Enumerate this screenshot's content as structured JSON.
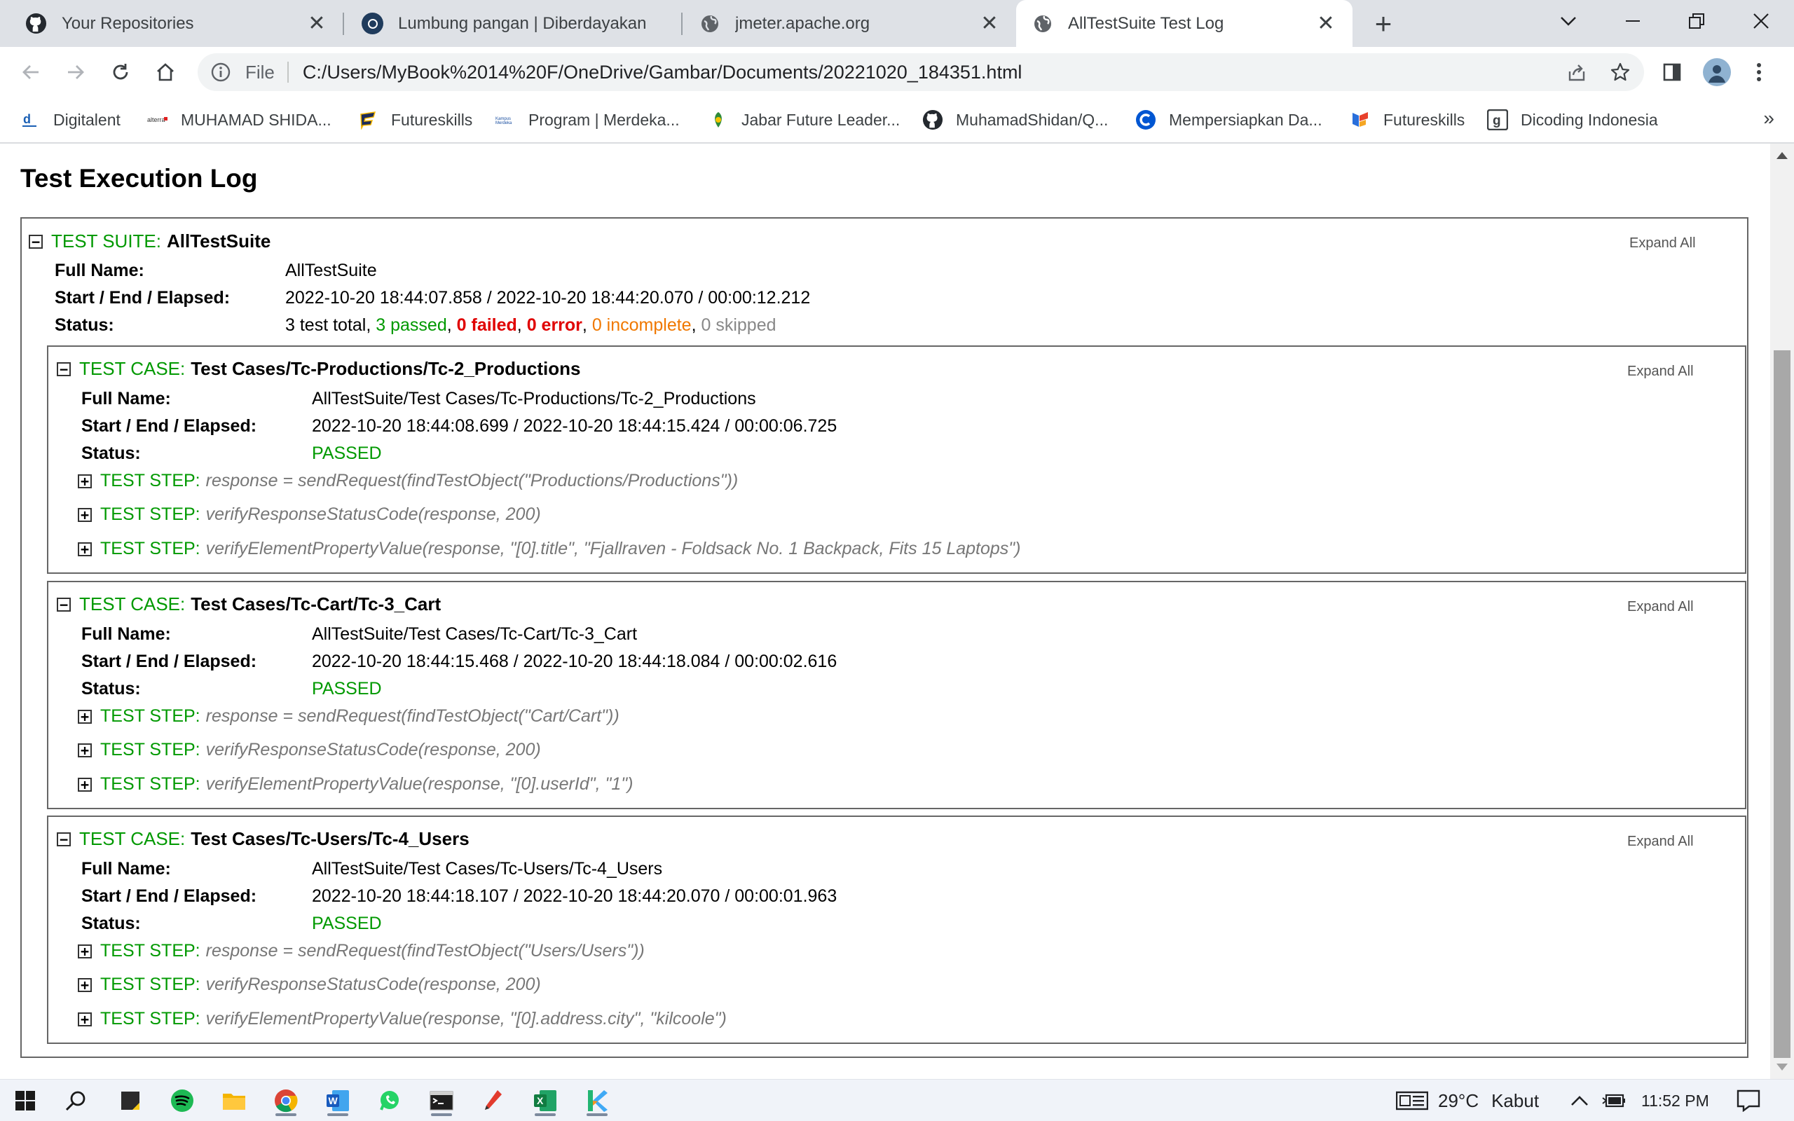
{
  "tabs": [
    {
      "title": "Your Repositories",
      "icon": "github-icon"
    },
    {
      "title": "Lumbung pangan | Diberdayakan",
      "icon": "site-icon"
    },
    {
      "title": "jmeter.apache.org",
      "icon": "globe-icon"
    },
    {
      "title": "AllTestSuite Test Log",
      "icon": "globe-icon"
    }
  ],
  "address": {
    "scheme_label": "File",
    "url": "C:/Users/MyBook%2014%20F/OneDrive/Gambar/Documents/20221020_184351.html"
  },
  "bookmarks": [
    {
      "label": "Digitalent"
    },
    {
      "label": "MUHAMAD SHIDA..."
    },
    {
      "label": "Futureskills"
    },
    {
      "label": "Program | Merdeka..."
    },
    {
      "label": "Jabar Future Leader..."
    },
    {
      "label": "MuhamadShidan/Q..."
    },
    {
      "label": "Mempersiapkan Da..."
    },
    {
      "label": "Futureskills"
    },
    {
      "label": "Dicoding Indonesia"
    }
  ],
  "bookmarks_more": "»",
  "page": {
    "title": "Test Execution Log",
    "expand_all": "Expand All",
    "labels": {
      "full_name": "Full Name:",
      "start_end": "Start / End / Elapsed:",
      "status": "Status:"
    },
    "suite": {
      "kind": "TEST SUITE:",
      "name": "AllTestSuite",
      "full_name": "AllTestSuite",
      "start_end": "2022-10-20 18:44:07.858 / 2022-10-20 18:44:20.070 / 00:00:12.212",
      "status": {
        "total": "3 test total",
        "passed": "3 passed",
        "failed": "0 failed",
        "error": "0 error",
        "incomplete": "0 incomplete",
        "skipped": "0 skipped"
      }
    },
    "cases": [
      {
        "kind": "TEST CASE:",
        "name": "Test Cases/Tc-Productions/Tc-2_Productions",
        "full_name": "AllTestSuite/Test Cases/Tc-Productions/Tc-2_Productions",
        "start_end": "2022-10-20 18:44:08.699 / 2022-10-20 18:44:15.424 / 00:00:06.725",
        "status": "PASSED",
        "steps": [
          {
            "kind": "TEST STEP:",
            "code": "response = sendRequest(findTestObject(\"Productions/Productions\"))"
          },
          {
            "kind": "TEST STEP:",
            "code": "verifyResponseStatusCode(response, 200)"
          },
          {
            "kind": "TEST STEP:",
            "code": "verifyElementPropertyValue(response, \"[0].title\", \"Fjallraven - Foldsack No. 1 Backpack, Fits 15 Laptops\")"
          }
        ]
      },
      {
        "kind": "TEST CASE:",
        "name": "Test Cases/Tc-Cart/Tc-3_Cart",
        "full_name": "AllTestSuite/Test Cases/Tc-Cart/Tc-3_Cart",
        "start_end": "2022-10-20 18:44:15.468 / 2022-10-20 18:44:18.084 / 00:00:02.616",
        "status": "PASSED",
        "steps": [
          {
            "kind": "TEST STEP:",
            "code": "response = sendRequest(findTestObject(\"Cart/Cart\"))"
          },
          {
            "kind": "TEST STEP:",
            "code": "verifyResponseStatusCode(response, 200)"
          },
          {
            "kind": "TEST STEP:",
            "code": "verifyElementPropertyValue(response, \"[0].userId\", \"1\")"
          }
        ]
      },
      {
        "kind": "TEST CASE:",
        "name": "Test Cases/Tc-Users/Tc-4_Users",
        "full_name": "AllTestSuite/Test Cases/Tc-Users/Tc-4_Users",
        "start_end": "2022-10-20 18:44:18.107 / 2022-10-20 18:44:20.070 / 00:00:01.963",
        "status": "PASSED",
        "steps": [
          {
            "kind": "TEST STEP:",
            "code": "response = sendRequest(findTestObject(\"Users/Users\"))"
          },
          {
            "kind": "TEST STEP:",
            "code": "verifyResponseStatusCode(response, 200)"
          },
          {
            "kind": "TEST STEP:",
            "code": "verifyElementPropertyValue(response, \"[0].address.city\", \"kilcoole\")"
          }
        ]
      }
    ]
  },
  "taskbar": {
    "apps": [
      "windows-start-icon",
      "search-icon",
      "sticky-notes-icon",
      "spotify-icon",
      "file-explorer-icon",
      "chrome-icon",
      "word-icon",
      "whatsapp-icon",
      "terminal-icon",
      "pen-app-icon",
      "excel-icon",
      "katalon-icon"
    ],
    "weather": {
      "temp": "29°C",
      "condition": "Kabut"
    },
    "time": "11:52 PM"
  },
  "colors": {
    "pass_green": "#009900",
    "fail_red": "#e00000",
    "incomplete_orange": "#f07800",
    "skipped_gray": "#888888",
    "tabstrip": "#dee1e6"
  }
}
